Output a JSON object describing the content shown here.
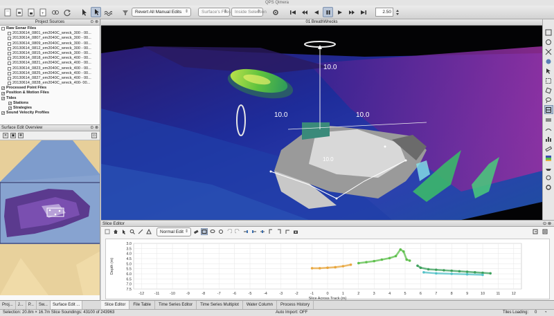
{
  "app": {
    "title": "QPS Qimera"
  },
  "toolbar": {
    "edit_mode": "Revert All Manual Edits",
    "surface_filter": "Surface's Files",
    "selection_filter": "Inside Selection",
    "speed_value": "2.50"
  },
  "project_sources": {
    "title": "Project Sources",
    "raw_sonar_label": "Raw Sonar Files",
    "raw_files": [
      "20130614_0801_em2040C_wreck_300 - 00...",
      "20130614_0807_em2040C_wreck_300 - 00...",
      "20130614_0809_em2040C_wreck_300 - 00...",
      "20130614_0812_em2040C_wreck_300 - 00...",
      "20130614_0815_em2040C_wreck_300 - 00...",
      "20130614_0818_em2040C_wreck_400 - 00...",
      "20130614_0821_em2040C_wreck_400 - 00...",
      "20130614_0823_em2040C_wreck_400 - 00...",
      "20130614_0825_em2040C_wreck_400 - 00...",
      "20130614_0827_em2040C_wreck_400 - 00...",
      "20130614_0828_em2040C_wreck_400- 00..."
    ],
    "groups": [
      {
        "label": "Processed Point Files",
        "checked": true,
        "indent": 0
      },
      {
        "label": "Position & Motion Files",
        "checked": true,
        "indent": 0
      },
      {
        "label": "Tides",
        "checked": true,
        "indent": 0
      },
      {
        "label": "Stations",
        "checked": true,
        "indent": 1
      },
      {
        "label": "Strategies",
        "checked": true,
        "indent": 1
      },
      {
        "label": "Sound Velocity Profiles",
        "checked": true,
        "indent": 0
      }
    ]
  },
  "surface_overview": {
    "title": "Surface Edit Overview"
  },
  "left_tabs": [
    "Proj...",
    "J...",
    "P...",
    "Sw...",
    "Surface Edit ..."
  ],
  "view3d": {
    "title": "01 BreathWrecks",
    "labels": [
      "10.0",
      "10.0",
      "10.0",
      "10.0"
    ]
  },
  "slice_editor": {
    "title": "Slice Editor",
    "mode": "Normal Edit",
    "y_axis_label": "Depth (m)",
    "x_axis_label": "Slice Across Track (m)"
  },
  "bottom_tabs": [
    "Slice Editor",
    "File Table",
    "Time Series Editor",
    "Time Series Multiplot",
    "Water Column",
    "Process History"
  ],
  "status": {
    "selection": "Selection: 20.8m × 16.7m  Slice Soundings: 43100 of 243963",
    "auto_import": "Auto Import: OFF",
    "tiles_loading": "Tiles Loading:",
    "tiles_count": "0"
  },
  "chart_data": {
    "type": "scatter",
    "xlabel": "Slice Across Track (m)",
    "ylabel": "Depth (m)",
    "xlim": [
      -12.5,
      12.5
    ],
    "ylim": [
      7.5,
      3.0
    ],
    "x_ticks": [
      "-12",
      "-11",
      "-10",
      "-9",
      "-8",
      "-7",
      "-6",
      "-5",
      "-4",
      "-3",
      "-2",
      "-1",
      "0",
      "1",
      "2",
      "3",
      "4",
      "5",
      "6",
      "7",
      "8",
      "9",
      "10",
      "11",
      "12"
    ],
    "y_ticks": [
      "3.0",
      "3.5",
      "4.0",
      "4.5",
      "5.0",
      "5.5",
      "6.0",
      "6.5",
      "7.0",
      "7.5"
    ],
    "series": [
      {
        "color": "#e8a53a",
        "points": [
          [
            -1.0,
            5.45
          ],
          [
            -0.5,
            5.45
          ],
          [
            0.0,
            5.4
          ],
          [
            0.5,
            5.35
          ],
          [
            1.0,
            5.25
          ],
          [
            1.5,
            5.1
          ]
        ]
      },
      {
        "color": "#5cbf4a",
        "points": [
          [
            2.0,
            4.95
          ],
          [
            2.5,
            4.85
          ],
          [
            3.0,
            4.75
          ],
          [
            3.5,
            4.6
          ],
          [
            4.0,
            4.45
          ],
          [
            4.4,
            4.25
          ],
          [
            4.7,
            3.6
          ],
          [
            4.9,
            3.8
          ],
          [
            5.1,
            4.6
          ],
          [
            5.3,
            4.7
          ]
        ]
      },
      {
        "color": "#3a9f5a",
        "points": [
          [
            5.8,
            5.2
          ],
          [
            6.0,
            5.4
          ],
          [
            6.5,
            5.55
          ],
          [
            7.0,
            5.6
          ],
          [
            7.5,
            5.65
          ],
          [
            8.0,
            5.7
          ],
          [
            8.5,
            5.75
          ],
          [
            9.0,
            5.8
          ],
          [
            9.5,
            5.85
          ],
          [
            10.0,
            5.9
          ],
          [
            10.5,
            5.95
          ]
        ]
      },
      {
        "color": "#4fc1c7",
        "points": [
          [
            6.2,
            5.85
          ],
          [
            7.0,
            5.95
          ],
          [
            8.0,
            6.0
          ],
          [
            9.0,
            6.05
          ],
          [
            10.0,
            6.1
          ]
        ]
      }
    ]
  }
}
